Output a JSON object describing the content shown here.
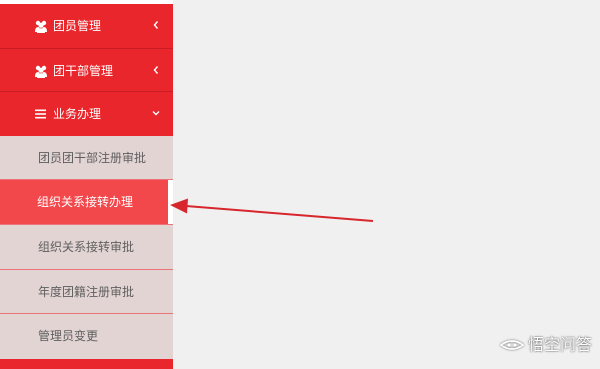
{
  "sidebar": {
    "groups": [
      {
        "label": "团员管理",
        "icon": "users-icon",
        "expanded": false
      },
      {
        "label": "团干部管理",
        "icon": "users-icon",
        "expanded": false
      },
      {
        "label": "业务办理",
        "icon": "list-icon",
        "expanded": true
      }
    ],
    "sub_items": [
      {
        "label": "团员团干部注册审批",
        "active": false
      },
      {
        "label": "组织关系接转办理",
        "active": true
      },
      {
        "label": "组织关系接转审批",
        "active": false
      },
      {
        "label": "年度团籍注册审批",
        "active": false
      },
      {
        "label": "管理员变更",
        "active": false
      }
    ]
  },
  "watermark": {
    "text": "悟空问答"
  },
  "colors": {
    "menu_red": "#e8262b",
    "active_red": "#f2474b",
    "submenu_bg": "#e3d4d4",
    "arrow": "#d7262c",
    "content_bg": "#f0f0f0"
  }
}
